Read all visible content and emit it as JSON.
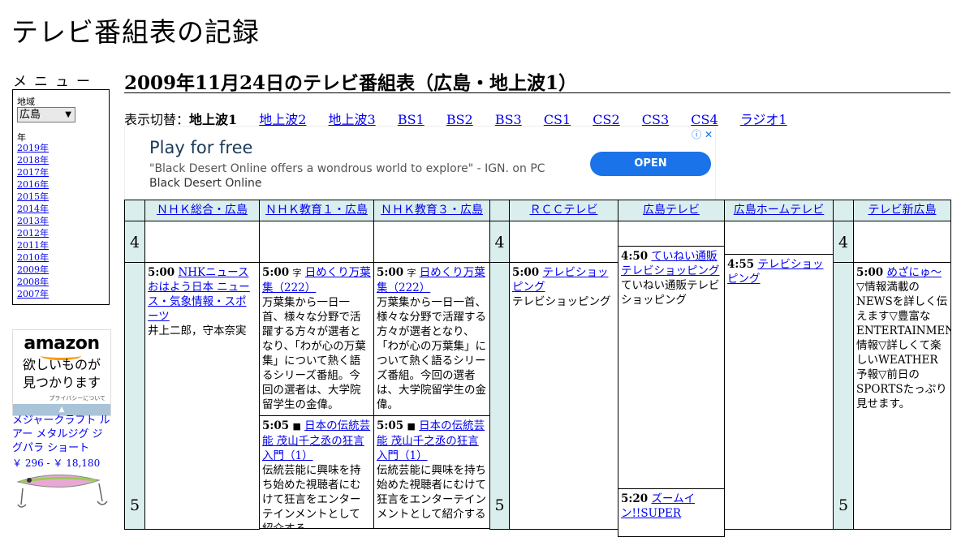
{
  "site": {
    "title": "テレビ番組表の記録"
  },
  "menu": {
    "label": "メニュー",
    "region_label": "地域",
    "region_value": "広島",
    "year_label": "年",
    "years": [
      "2019年",
      "2018年",
      "2017年",
      "2016年",
      "2015年",
      "2014年",
      "2013年",
      "2012年",
      "2011年",
      "2010年",
      "2009年",
      "2008年",
      "2007年"
    ]
  },
  "amazon": {
    "logo": "amazon",
    "line1": "欲しいものが",
    "line2": "見つかります",
    "privacy": "プライバシーについて",
    "product": "メジャークラフト ルアー メタルジグ ジグパラ ショート",
    "price": "￥ 296 - ￥ 18,180"
  },
  "heading": "2009年11月24日のテレビ番組表（広島・地上波1）",
  "switch": {
    "label": "表示切替：",
    "current": "地上波1",
    "links": [
      "地上波2",
      "地上波3",
      "BS1",
      "BS2",
      "BS3",
      "CS1",
      "CS2",
      "CS3",
      "CS4",
      "ラジオ1"
    ]
  },
  "ad": {
    "title": "Play for free",
    "desc": "\"Black Desert Online offers a wondrous world to explore\" - IGN. on PC",
    "brand": "Black Desert Online",
    "button": "OPEN",
    "icons": "ⓘ ✕"
  },
  "channels": [
    "ＮＨＫ総合・広島",
    "ＮＨＫ教育１・広島",
    "ＮＨＫ教育３・広島",
    "ＲＣＣテレビ",
    "広島テレビ",
    "広島ホームテレビ",
    "テレビ新広島"
  ],
  "hours": [
    "4",
    "5"
  ],
  "programs": {
    "nhk_g": {
      "time": "5:00",
      "title": "NHKニュース おはよう日本 ニュース・気象情報・スポーツ",
      "desc": "井上二郎，守本奈実"
    },
    "edu1_a": {
      "time": "5:00",
      "icon": "字",
      "title": "日めくり万葉集（222）",
      "desc": "万葉集から一日一首、様々な分野で活躍する方々が選者となり、「わが心の万葉集」について熱く語るシリーズ番組。今回の選者は、大学院留学生の金偉。"
    },
    "edu1_b": {
      "time": "5:05",
      "icon": "■",
      "title": "日本の伝統芸能 茂山千之丞の狂言入門（1）",
      "desc": "伝統芸能に興味を持ち始めた視聴者にむけて狂言をエンターテインメントとして紹介する"
    },
    "edu3_a": {
      "time": "5:00",
      "icon": "字",
      "title": "日めくり万葉集（222）",
      "desc": "万葉集から一日一首、様々な分野で活躍する方々が選者となり、「わが心の万葉集」について熱く語るシリーズ番組。今回の選者は、大学院留学生の金偉。"
    },
    "edu3_b": {
      "time": "5:05",
      "icon": "■",
      "title": "日本の伝統芸能 茂山千之丞の狂言入門（1）",
      "desc": "伝統芸能に興味を持ち始めた視聴者にむけて狂言をエンターテインメントとして紹介する"
    },
    "rcc": {
      "time": "5:00",
      "title": "テレビショッピング",
      "desc": "テレビショッピング"
    },
    "htv_a": {
      "time": "4:50",
      "title": "ていねい通販テレビショッピング",
      "desc": "ていねい通販テレビショッピング"
    },
    "htv_b": {
      "time": "5:20",
      "title": "ズームイン!!SUPER",
      "desc": ""
    },
    "home": {
      "time": "4:55",
      "title": "テレビショッピング",
      "desc": ""
    },
    "tss": {
      "time": "5:00",
      "title": "めざにゅ～",
      "desc": "▽情報満載のNEWSを詳しく伝えます▽豊富なENTERTAINMENT情報▽詳しくて楽しいWEATHER予報▽前日のSPORTSたっぷり見せます。"
    }
  }
}
